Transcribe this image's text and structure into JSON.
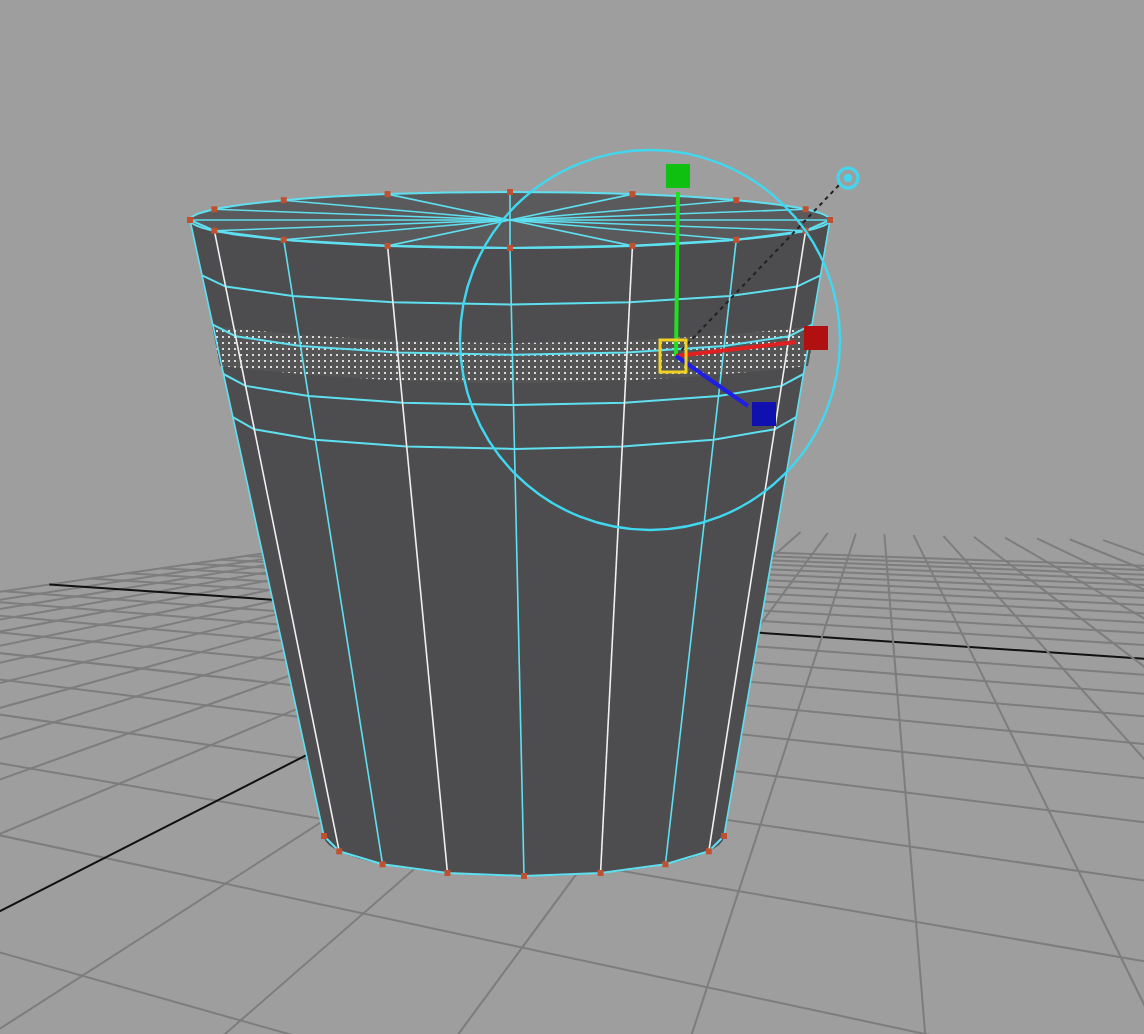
{
  "viewport": {
    "show_grid": true,
    "manipulator": {
      "kind": "move"
    },
    "selected_edge_loop": true
  }
}
